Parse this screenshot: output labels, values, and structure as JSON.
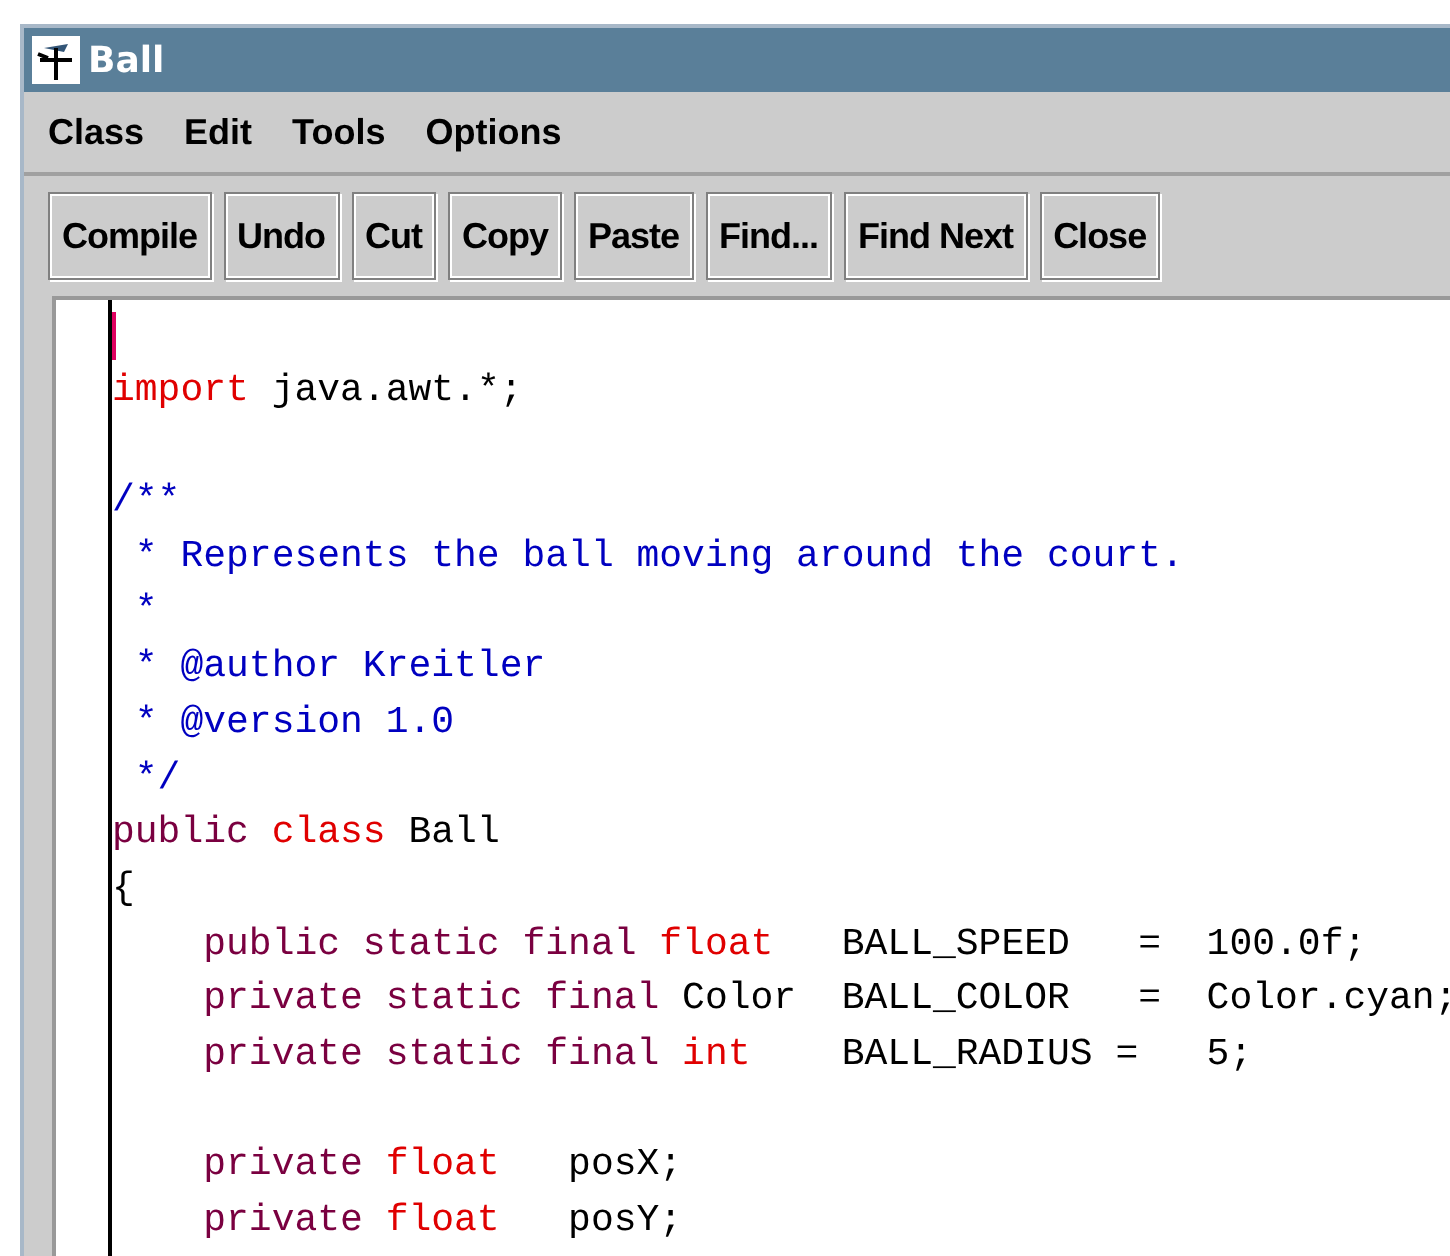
{
  "window": {
    "title": "Ball"
  },
  "menu": [
    "Class",
    "Edit",
    "Tools",
    "Options"
  ],
  "toolbar": [
    "Compile",
    "Undo",
    "Cut",
    "Copy",
    "Paste",
    "Find...",
    "Find Next",
    "Close"
  ],
  "editor": {
    "blocks": [
      [
        [
          {
            "kind": "caret"
          }
        ],
        [
          {
            "kind": "type",
            "text": "import"
          },
          {
            "kind": "plain",
            "text": " java.awt.*;"
          }
        ]
      ],
      [
        [
          {
            "kind": "comment",
            "text": "/**"
          }
        ],
        [
          {
            "kind": "comment",
            "text": " * Represents the ball moving around the court."
          }
        ],
        [
          {
            "kind": "comment",
            "text": " *"
          }
        ],
        [
          {
            "kind": "comment",
            "text": " * @author Kreitler"
          }
        ],
        [
          {
            "kind": "comment",
            "text": " * @version 1.0"
          }
        ],
        [
          {
            "kind": "comment",
            "text": " */"
          }
        ],
        [
          {
            "kind": "keyword",
            "text": "public"
          },
          {
            "kind": "type",
            "text": " class"
          },
          {
            "kind": "plain",
            "text": " Ball"
          }
        ],
        [
          {
            "kind": "plain",
            "text": "{"
          }
        ],
        [
          {
            "kind": "keyword",
            "text": "    public static final "
          },
          {
            "kind": "type",
            "text": "float"
          },
          {
            "kind": "plain",
            "text": "   BALL_SPEED   =  100.0f;"
          }
        ],
        [
          {
            "kind": "keyword",
            "text": "    private static final "
          },
          {
            "kind": "plain",
            "text": "Color  BALL_COLOR   =  Color.cyan;"
          }
        ],
        [
          {
            "kind": "keyword",
            "text": "    private static final "
          },
          {
            "kind": "type",
            "text": "int"
          },
          {
            "kind": "plain",
            "text": "    BALL_RADIUS =   5;"
          }
        ]
      ],
      [
        [
          {
            "kind": "keyword",
            "text": "    private "
          },
          {
            "kind": "type",
            "text": "float"
          },
          {
            "kind": "plain",
            "text": "   posX;"
          }
        ],
        [
          {
            "kind": "keyword",
            "text": "    private "
          },
          {
            "kind": "type",
            "text": "float"
          },
          {
            "kind": "plain",
            "text": "   posY;"
          }
        ]
      ]
    ]
  }
}
